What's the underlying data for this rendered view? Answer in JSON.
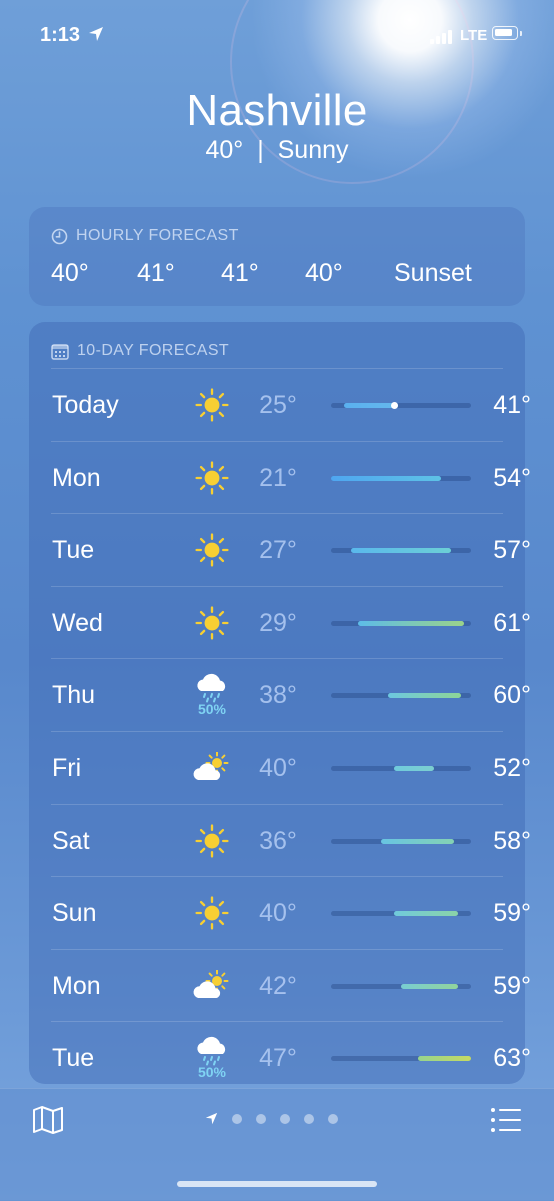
{
  "status": {
    "time": "1:13",
    "network": "LTE"
  },
  "header": {
    "city": "Nashville",
    "temp": "40°",
    "condition": "Sunny"
  },
  "hourly": {
    "title": "HOURLY FORECAST",
    "items": [
      "40°",
      "41°",
      "41°",
      "40°",
      "Sunset"
    ]
  },
  "tenday": {
    "title": "10-DAY FORECAST",
    "scale": {
      "min": 21,
      "max": 63
    },
    "current_temp": 40,
    "days": [
      {
        "day": "Today",
        "icon": "sun-icon",
        "precip": "",
        "low": "25°",
        "high": "41°",
        "lo_val": 25,
        "hi_val": 41,
        "colors": [
          "#5ab0ef",
          "#65b8ec"
        ]
      },
      {
        "day": "Mon",
        "icon": "sun-icon",
        "precip": "",
        "low": "21°",
        "high": "54°",
        "lo_val": 21,
        "hi_val": 54,
        "colors": [
          "#4fa6f0",
          "#5ec2e6"
        ]
      },
      {
        "day": "Tue",
        "icon": "sun-icon",
        "precip": "",
        "low": "27°",
        "high": "57°",
        "lo_val": 27,
        "hi_val": 57,
        "colors": [
          "#5ab8ec",
          "#6ccfd6"
        ]
      },
      {
        "day": "Wed",
        "icon": "sun-icon",
        "precip": "",
        "low": "29°",
        "high": "61°",
        "lo_val": 29,
        "hi_val": 61,
        "colors": [
          "#5dbce8",
          "#9ad38a"
        ]
      },
      {
        "day": "Thu",
        "icon": "rain-cloud-icon",
        "precip": "50%",
        "low": "38°",
        "high": "60°",
        "lo_val": 38,
        "hi_val": 60,
        "colors": [
          "#6cc8e0",
          "#8ed596"
        ]
      },
      {
        "day": "Fri",
        "icon": "partly-cloudy-icon",
        "precip": "",
        "low": "40°",
        "high": "52°",
        "lo_val": 40,
        "hi_val": 52,
        "colors": [
          "#70cadc",
          "#7ccfd0"
        ]
      },
      {
        "day": "Sat",
        "icon": "sun-icon",
        "precip": "",
        "low": "36°",
        "high": "58°",
        "lo_val": 36,
        "hi_val": 58,
        "colors": [
          "#68c4e2",
          "#84d2b4"
        ]
      },
      {
        "day": "Sun",
        "icon": "sun-icon",
        "precip": "",
        "low": "40°",
        "high": "59°",
        "lo_val": 40,
        "hi_val": 59,
        "colors": [
          "#70cadc",
          "#8ad3a8"
        ]
      },
      {
        "day": "Mon",
        "icon": "partly-cloudy-icon",
        "precip": "",
        "low": "42°",
        "high": "59°",
        "lo_val": 42,
        "hi_val": 59,
        "colors": [
          "#78cdd2",
          "#92d49c"
        ]
      },
      {
        "day": "Tue",
        "icon": "rain-cloud-icon",
        "precip": "50%",
        "low": "47°",
        "high": "63°",
        "lo_val": 47,
        "hi_val": 63,
        "colors": [
          "#96d48e",
          "#c6da62"
        ]
      }
    ]
  },
  "toolbar": {
    "map_icon": "map-icon",
    "list_icon": "list-icon",
    "page_count": 5,
    "current_page": "location"
  }
}
